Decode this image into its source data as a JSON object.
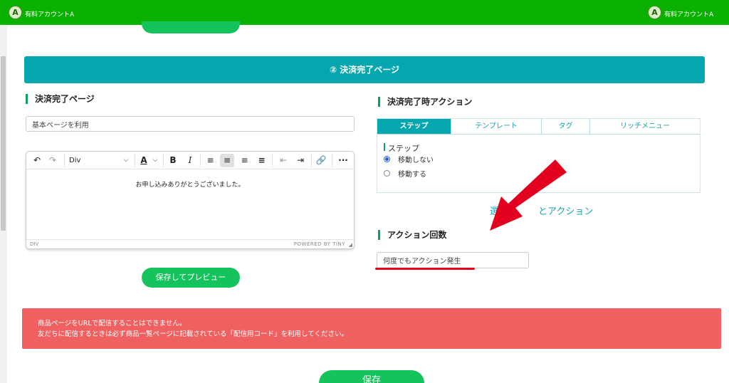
{
  "header": {
    "avatar_initial": "A",
    "account_left": "有料アカウントA",
    "account_right": "有料アカウントA",
    "bg_color": "#0bb100"
  },
  "section": {
    "title": "② 決済完了ページ",
    "color": "#06a6ae"
  },
  "left": {
    "title": "決済完了ページ",
    "page_select_value": "基本ページを利用",
    "editor": {
      "block_format": "Div",
      "content": "お申し込みありがとうございました。",
      "status_path": "DIV",
      "powered_by": "POWERED BY TINY"
    },
    "preview_button": "保存してプレビュー"
  },
  "right": {
    "title": "決済完了時アクション",
    "tabs": [
      {
        "label": "ステップ",
        "active": true
      },
      {
        "label": "テンプレート",
        "active": false
      },
      {
        "label": "タグ",
        "active": false
      },
      {
        "label": "リッチメニュー",
        "active": false
      }
    ],
    "step_label": "ステップ",
    "options": [
      {
        "label": "移動しない",
        "selected": true
      },
      {
        "label": "移動する",
        "selected": false
      }
    ],
    "action_link_partial": "選",
    "action_link_rest": "とアクション",
    "count_title": "アクション回数",
    "count_value": "何度でもアクション発生"
  },
  "alert": {
    "line1": "商品ページをURLで配信することはできません。",
    "line2": "友だちに配信するときは必ず商品一覧ページに記載されている「配信用コード」を利用してください。",
    "color": "#ef6161"
  },
  "save_button": "保存",
  "annotation_color": "#e3001e"
}
